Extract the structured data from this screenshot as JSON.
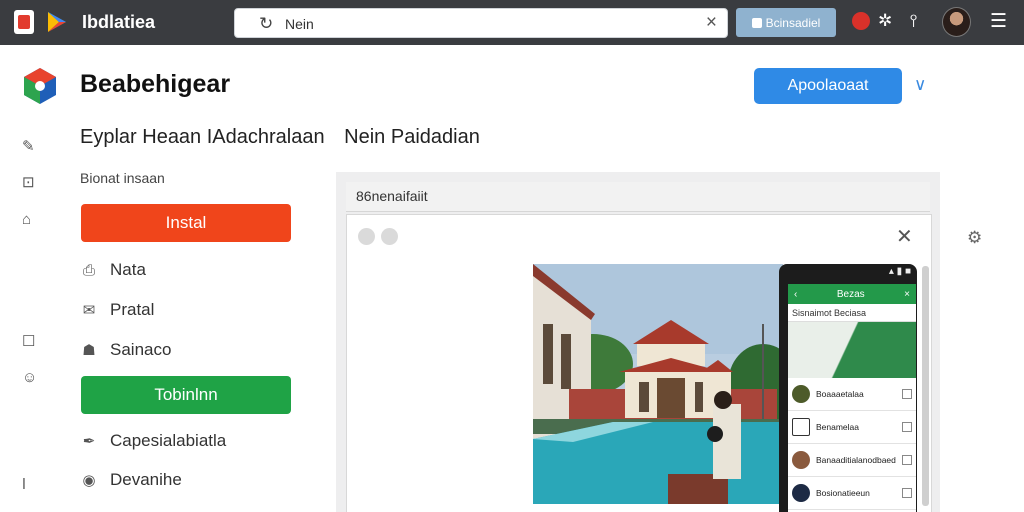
{
  "topbar": {
    "app_title": "Ibdlatiea",
    "address": {
      "text": "Nein"
    },
    "button_label": "Bcinsadiel"
  },
  "header": {
    "app_name": "Beabehigear",
    "primary_button": "Apoolaoaat"
  },
  "page": {
    "title_part1": "Eyplar Heaan IAdachralaan",
    "title_part2": "Nein Paidadian"
  },
  "actions": {
    "section_label": "Bionat insaan",
    "install_button": "Instal",
    "items": [
      {
        "label": "Nata",
        "icon": "note-icon"
      },
      {
        "label": "Pratal",
        "icon": "mail-icon"
      },
      {
        "label": "Sainaco",
        "icon": "person-icon"
      }
    ],
    "green_button": "Tobinlnn",
    "items2": [
      {
        "label": "Capesialabiatla",
        "icon": "pen-icon"
      },
      {
        "label": "Devanihe",
        "icon": "circle-icon"
      }
    ]
  },
  "preview": {
    "header_label": "86nenaifaiit",
    "phone": {
      "top_label": "Bezas",
      "sub_label": "Sisnaimot Beciasa",
      "rows": [
        {
          "text": "Boaaaetalaa",
          "thumb_color": "#4d5b2a"
        },
        {
          "text": "Benamelaa",
          "thumb_color": "#ffffff"
        },
        {
          "text": "Banaaditialanodbaed",
          "thumb_color": "#8a5a3e"
        },
        {
          "text": "Bosionatieeun",
          "thumb_color": "#1d2a44"
        }
      ]
    }
  },
  "colors": {
    "topbar": "#3a3c40",
    "install": "#f0451b",
    "green": "#1fa346",
    "primary": "#2f8ae6"
  }
}
